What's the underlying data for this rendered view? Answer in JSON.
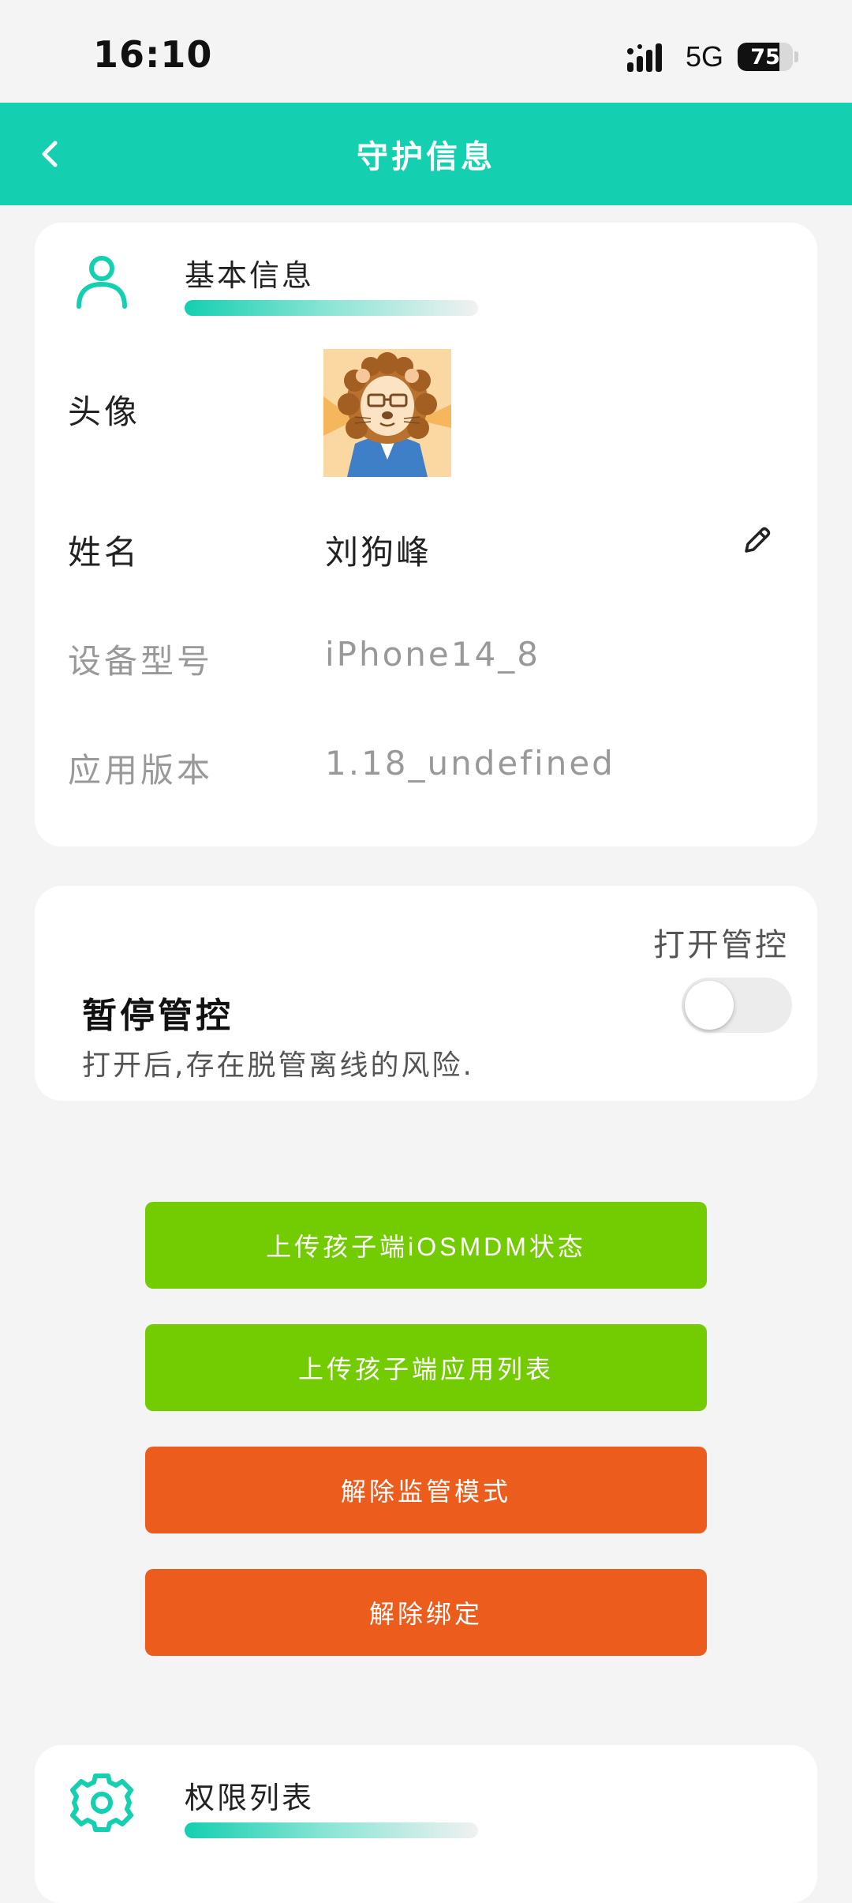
{
  "status_bar": {
    "time": "16:10",
    "network": "5G",
    "battery": "75",
    "battery_level": 0.75
  },
  "nav": {
    "title": "守护信息",
    "back_icon": "chevron-left-icon"
  },
  "basic_info": {
    "section_title": "基本信息",
    "section_icon": "user-icon",
    "rows": {
      "avatar_label": "头像",
      "name_label": "姓名",
      "name_value": "刘狗峰",
      "device_label": "设备型号",
      "device_value": "iPhone14_8",
      "version_label": "应用版本",
      "version_value": "1.18_undefined"
    },
    "edit_icon": "pencil-icon"
  },
  "control": {
    "toggle_label": "打开管控",
    "title": "暂停管控",
    "description": "打开后,存在脱管离线的风险.",
    "toggle_on": false
  },
  "actions": [
    {
      "label": "上传孩子端iOSMDM状态",
      "color": "#73cc02"
    },
    {
      "label": "上传孩子端应用列表",
      "color": "#73cc02"
    },
    {
      "label": "解除监管模式",
      "color": "#ec5c1d"
    },
    {
      "label": "解除绑定",
      "color": "#ec5c1d"
    }
  ],
  "permissions": {
    "section_title": "权限列表",
    "section_icon": "gear-icon"
  },
  "colors": {
    "accent": "#14cfb0",
    "green_button": "#73cc02",
    "orange_button": "#ec5c1d"
  }
}
